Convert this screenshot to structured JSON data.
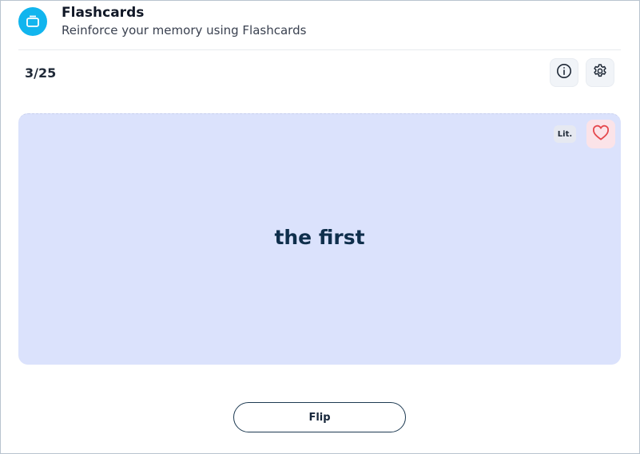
{
  "header": {
    "title": "Flashcards",
    "subtitle": "Reinforce your memory using Flashcards",
    "icon": "flashcards-icon"
  },
  "toolbar": {
    "counter": "3/25",
    "info_icon": "info-icon",
    "settings_icon": "gear-icon"
  },
  "card": {
    "term": "the first",
    "badge": "Lit.",
    "favorite_icon": "heart-icon"
  },
  "actions": {
    "flip_label": "Flip"
  },
  "colors": {
    "accent": "#11b5ee",
    "card_background": "#dbe2fc",
    "favorite_background": "#fbe3e8",
    "heart": "#e5484d",
    "term_text": "#0f2f4c"
  }
}
